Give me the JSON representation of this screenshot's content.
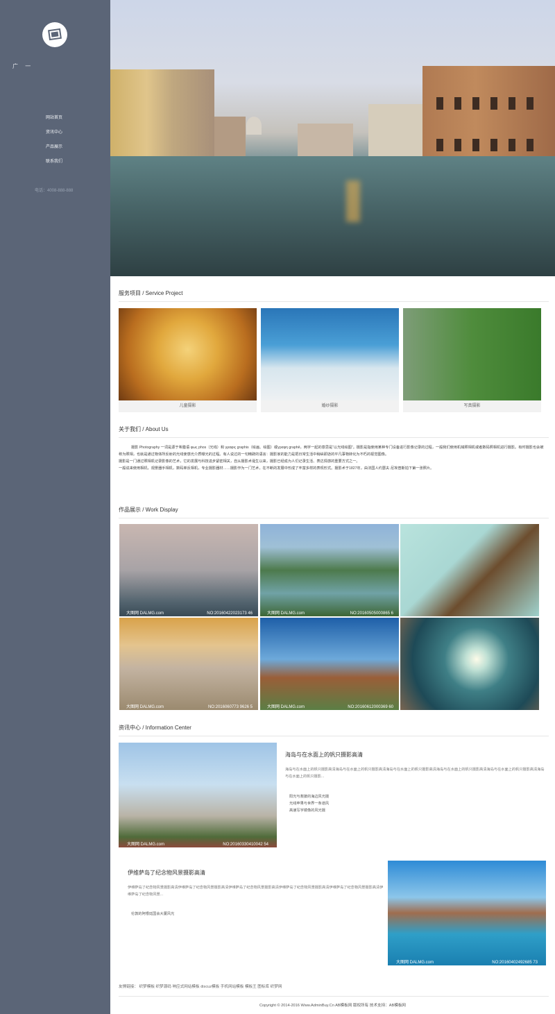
{
  "sidebar": {
    "brand": "广 一",
    "nav": [
      {
        "label": "网站首页"
      },
      {
        "label": "资讯中心"
      },
      {
        "label": "产品展示"
      },
      {
        "label": "联系我们"
      }
    ],
    "phone": "电话：4008-888-888"
  },
  "services": {
    "title": "服务项目 / Service Project",
    "items": [
      {
        "label": "儿童摄影"
      },
      {
        "label": "婚纱摄影"
      },
      {
        "label": "写真摄影"
      }
    ]
  },
  "about": {
    "title": "关于我们 / About Us",
    "paragraphs": [
      "摄影 Photography 一词是源于希腊语 φως phos（光线）和 γραφις graphis（绘画、绘图）或γραφη graphê，两字一起的意思是“以光线绘图”。摄影是指使用某种专门设备进行影像记录的过程，一般我们使用机械照相机或者数码照相机进行摄影。有时摄影也会被称为照相，也就是通过物体所反射的光线使感光介质曝光的过程。有人说过的一句精辟的语言：摄影家的能力是把日常生活中稍纵即逝的平凡事物转化为不朽的视觉图像。",
      "摄影是一门通过照相机记录影像的艺术，它的发展与科技进步紧密相关，自从摄影术诞生以来，摄影已经成为人们记录生活、表达情感的重要方式之一。",
      "一般说来使用相机，观景器手相机，数码单反相机，专业摄影器材……摄影作为一门艺术，在不断的发展中形成了丰富多样的表现形式。摄影术于1827年，由法国人约瑟夫·尼埃普斯拍下第一张照片。"
    ]
  },
  "works": {
    "title": "作品展示 / Work Display",
    "items": [
      {
        "watermark": "大图网 DALMG.com",
        "number": "NO:20160422023173 46"
      },
      {
        "watermark": "大图网 DALMG.com",
        "number": "NO:20160505000865 6"
      },
      {
        "watermark": "",
        "number": ""
      },
      {
        "watermark": "大图网 DALMG.com",
        "number": "NO:2016060773 9626 5"
      },
      {
        "watermark": "大图网 DALMG.com",
        "number": "NO:20160612000369 60"
      },
      {
        "watermark": "",
        "number": ""
      }
    ]
  },
  "info": {
    "title": "资讯中心 / Information Center",
    "article1": {
      "title": "海岛与在水面上的帆只摄影高清",
      "desc": "海岛与在水面上的帆只摄影高清海岛与在水面上的帆只摄影高清海岛与在水面上的帆只摄影高清海岛与在水面上的帆只摄影高清海岛与在水面上的帆只摄影高清海岛与在水面上的帆只摄影...",
      "list": [
        "阳光与救援的海边风光摄",
        "光线苹果与世界一条道风",
        "高速写字镜像的风光摄"
      ],
      "watermark": "大图网 DALMG.com",
      "number": "NO:20160330410042 54"
    },
    "article2": {
      "title": "伊维萨岛了纪念物风景摄影高清",
      "desc": "伊维萨岛了纪念物风景摄影高清伊维萨岛了纪念物风景摄影高清伊维萨岛了纪念物风景摄影高清伊维萨岛了纪念物风景摄影高清伊维萨岛了纪念物风景摄影高清伊维萨岛了纪念物风景...",
      "list": [
        "伦敦的阿根廷国会大厦风光"
      ],
      "watermark": "大图网 DALMG.com",
      "number": "NO:20160402492685 73"
    }
  },
  "footer": {
    "links_label": "友情链接：",
    "links": [
      "织梦模板",
      "织梦源码",
      "响应式网站模板",
      "discuz模板",
      "手机网站模板",
      "模板王",
      "图标库",
      "织梦网"
    ],
    "copyright": "Copyright © 2014-2016 Www.AdminBuy.Cn AB模板网 版权所有 技术支持：AB模板网"
  }
}
